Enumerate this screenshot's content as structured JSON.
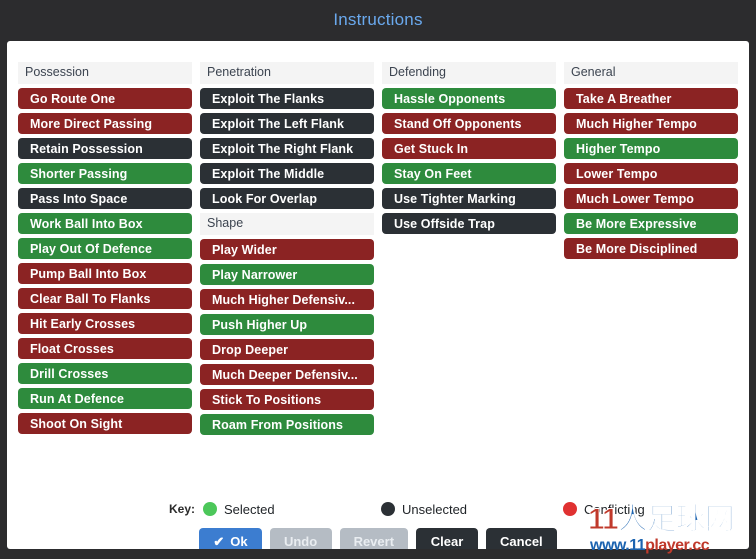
{
  "window": {
    "title": "Instructions",
    "title_color": "#6aa9ee",
    "background_color": "#2c2c2e"
  },
  "status_colors": {
    "selected": "#2e8b3d",
    "unselected": "#2b3035",
    "conflicting": "#8b2323"
  },
  "columns": [
    {
      "header": "Possession",
      "options": [
        {
          "label": "Go Route One",
          "state": "conflicting"
        },
        {
          "label": "More Direct Passing",
          "state": "conflicting"
        },
        {
          "label": "Retain Possession",
          "state": "unselected"
        },
        {
          "label": "Shorter Passing",
          "state": "selected"
        },
        {
          "label": "Pass Into Space",
          "state": "unselected"
        },
        {
          "label": "Work Ball Into Box",
          "state": "selected"
        },
        {
          "label": "Play Out Of Defence",
          "state": "selected"
        },
        {
          "label": "Pump Ball Into Box",
          "state": "conflicting"
        },
        {
          "label": "Clear Ball To Flanks",
          "state": "conflicting"
        },
        {
          "label": "Hit Early Crosses",
          "state": "conflicting"
        },
        {
          "label": "Float Crosses",
          "state": "conflicting"
        },
        {
          "label": "Drill Crosses",
          "state": "selected"
        },
        {
          "label": "Run At Defence",
          "state": "selected"
        },
        {
          "label": "Shoot On Sight",
          "state": "conflicting"
        }
      ]
    },
    {
      "header": "Penetration",
      "options": [
        {
          "label": "Exploit The Flanks",
          "state": "unselected"
        },
        {
          "label": "Exploit The Left Flank",
          "state": "unselected"
        },
        {
          "label": "Exploit The Right Flank",
          "state": "unselected"
        },
        {
          "label": "Exploit The Middle",
          "state": "unselected"
        },
        {
          "label": "Look For Overlap",
          "state": "unselected"
        }
      ],
      "subgroup": {
        "header": "Shape",
        "options": [
          {
            "label": "Play Wider",
            "state": "conflicting"
          },
          {
            "label": "Play Narrower",
            "state": "selected"
          },
          {
            "label": "Much Higher Defensiv...",
            "state": "conflicting"
          },
          {
            "label": "Push Higher Up",
            "state": "selected"
          },
          {
            "label": "Drop Deeper",
            "state": "conflicting"
          },
          {
            "label": "Much Deeper Defensiv...",
            "state": "conflicting"
          },
          {
            "label": "Stick To Positions",
            "state": "conflicting"
          },
          {
            "label": "Roam From Positions",
            "state": "selected"
          }
        ]
      }
    },
    {
      "header": "Defending",
      "options": [
        {
          "label": "Hassle Opponents",
          "state": "selected"
        },
        {
          "label": "Stand Off Opponents",
          "state": "conflicting"
        },
        {
          "label": "Get Stuck In",
          "state": "conflicting"
        },
        {
          "label": "Stay On Feet",
          "state": "selected"
        },
        {
          "label": "Use Tighter Marking",
          "state": "unselected"
        },
        {
          "label": "Use Offside Trap",
          "state": "unselected"
        }
      ]
    },
    {
      "header": "General",
      "options": [
        {
          "label": "Take A Breather",
          "state": "conflicting"
        },
        {
          "label": "Much Higher Tempo",
          "state": "conflicting"
        },
        {
          "label": "Higher Tempo",
          "state": "selected"
        },
        {
          "label": "Lower Tempo",
          "state": "conflicting"
        },
        {
          "label": "Much Lower Tempo",
          "state": "conflicting"
        },
        {
          "label": "Be More Expressive",
          "state": "selected"
        },
        {
          "label": "Be More Disciplined",
          "state": "conflicting"
        }
      ]
    }
  ],
  "legend": {
    "key_label": "Key:",
    "items": [
      {
        "label": "Selected",
        "color": "#4cc75a"
      },
      {
        "label": "Unselected",
        "color": "#2b3035"
      },
      {
        "label": "Conflicting",
        "color": "#e03131"
      }
    ]
  },
  "buttons": [
    {
      "label": "Ok",
      "style": "primary",
      "icon": "check-icon",
      "enabled": true
    },
    {
      "label": "Undo",
      "style": "disabled",
      "icon": "",
      "enabled": false
    },
    {
      "label": "Revert",
      "style": "disabled",
      "icon": "",
      "enabled": false
    },
    {
      "label": "Clear",
      "style": "dark",
      "icon": "",
      "enabled": true
    },
    {
      "label": "Cancel",
      "style": "dark",
      "icon": "",
      "enabled": true
    }
  ],
  "watermark": {
    "line1_a": "11",
    "line1_b": "人足球网",
    "line2_a": "www.11",
    "line2_b": "player.cc"
  }
}
